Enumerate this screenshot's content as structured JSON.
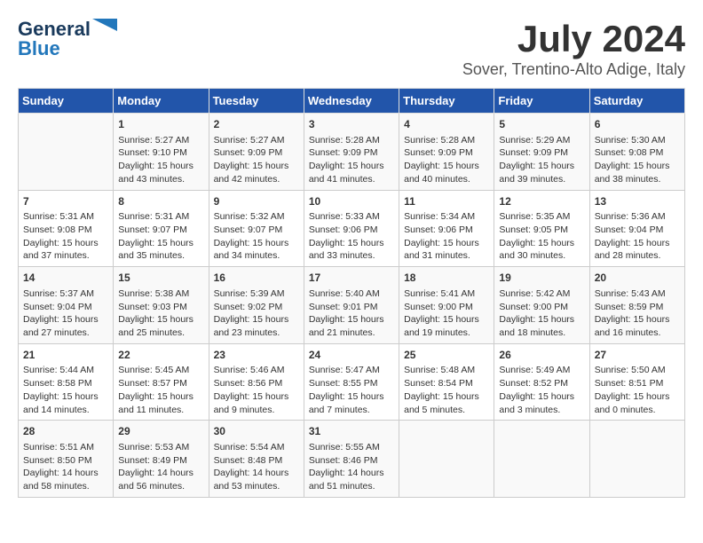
{
  "header": {
    "logo_line1": "General",
    "logo_line2": "Blue",
    "title": "July 2024",
    "location": "Sover, Trentino-Alto Adige, Italy"
  },
  "columns": [
    "Sunday",
    "Monday",
    "Tuesday",
    "Wednesday",
    "Thursday",
    "Friday",
    "Saturday"
  ],
  "weeks": [
    [
      {
        "day": "",
        "content": ""
      },
      {
        "day": "1",
        "content": "Sunrise: 5:27 AM\nSunset: 9:10 PM\nDaylight: 15 hours\nand 43 minutes."
      },
      {
        "day": "2",
        "content": "Sunrise: 5:27 AM\nSunset: 9:09 PM\nDaylight: 15 hours\nand 42 minutes."
      },
      {
        "day": "3",
        "content": "Sunrise: 5:28 AM\nSunset: 9:09 PM\nDaylight: 15 hours\nand 41 minutes."
      },
      {
        "day": "4",
        "content": "Sunrise: 5:28 AM\nSunset: 9:09 PM\nDaylight: 15 hours\nand 40 minutes."
      },
      {
        "day": "5",
        "content": "Sunrise: 5:29 AM\nSunset: 9:09 PM\nDaylight: 15 hours\nand 39 minutes."
      },
      {
        "day": "6",
        "content": "Sunrise: 5:30 AM\nSunset: 9:08 PM\nDaylight: 15 hours\nand 38 minutes."
      }
    ],
    [
      {
        "day": "7",
        "content": "Sunrise: 5:31 AM\nSunset: 9:08 PM\nDaylight: 15 hours\nand 37 minutes."
      },
      {
        "day": "8",
        "content": "Sunrise: 5:31 AM\nSunset: 9:07 PM\nDaylight: 15 hours\nand 35 minutes."
      },
      {
        "day": "9",
        "content": "Sunrise: 5:32 AM\nSunset: 9:07 PM\nDaylight: 15 hours\nand 34 minutes."
      },
      {
        "day": "10",
        "content": "Sunrise: 5:33 AM\nSunset: 9:06 PM\nDaylight: 15 hours\nand 33 minutes."
      },
      {
        "day": "11",
        "content": "Sunrise: 5:34 AM\nSunset: 9:06 PM\nDaylight: 15 hours\nand 31 minutes."
      },
      {
        "day": "12",
        "content": "Sunrise: 5:35 AM\nSunset: 9:05 PM\nDaylight: 15 hours\nand 30 minutes."
      },
      {
        "day": "13",
        "content": "Sunrise: 5:36 AM\nSunset: 9:04 PM\nDaylight: 15 hours\nand 28 minutes."
      }
    ],
    [
      {
        "day": "14",
        "content": "Sunrise: 5:37 AM\nSunset: 9:04 PM\nDaylight: 15 hours\nand 27 minutes."
      },
      {
        "day": "15",
        "content": "Sunrise: 5:38 AM\nSunset: 9:03 PM\nDaylight: 15 hours\nand 25 minutes."
      },
      {
        "day": "16",
        "content": "Sunrise: 5:39 AM\nSunset: 9:02 PM\nDaylight: 15 hours\nand 23 minutes."
      },
      {
        "day": "17",
        "content": "Sunrise: 5:40 AM\nSunset: 9:01 PM\nDaylight: 15 hours\nand 21 minutes."
      },
      {
        "day": "18",
        "content": "Sunrise: 5:41 AM\nSunset: 9:00 PM\nDaylight: 15 hours\nand 19 minutes."
      },
      {
        "day": "19",
        "content": "Sunrise: 5:42 AM\nSunset: 9:00 PM\nDaylight: 15 hours\nand 18 minutes."
      },
      {
        "day": "20",
        "content": "Sunrise: 5:43 AM\nSunset: 8:59 PM\nDaylight: 15 hours\nand 16 minutes."
      }
    ],
    [
      {
        "day": "21",
        "content": "Sunrise: 5:44 AM\nSunset: 8:58 PM\nDaylight: 15 hours\nand 14 minutes."
      },
      {
        "day": "22",
        "content": "Sunrise: 5:45 AM\nSunset: 8:57 PM\nDaylight: 15 hours\nand 11 minutes."
      },
      {
        "day": "23",
        "content": "Sunrise: 5:46 AM\nSunset: 8:56 PM\nDaylight: 15 hours\nand 9 minutes."
      },
      {
        "day": "24",
        "content": "Sunrise: 5:47 AM\nSunset: 8:55 PM\nDaylight: 15 hours\nand 7 minutes."
      },
      {
        "day": "25",
        "content": "Sunrise: 5:48 AM\nSunset: 8:54 PM\nDaylight: 15 hours\nand 5 minutes."
      },
      {
        "day": "26",
        "content": "Sunrise: 5:49 AM\nSunset: 8:52 PM\nDaylight: 15 hours\nand 3 minutes."
      },
      {
        "day": "27",
        "content": "Sunrise: 5:50 AM\nSunset: 8:51 PM\nDaylight: 15 hours\nand 0 minutes."
      }
    ],
    [
      {
        "day": "28",
        "content": "Sunrise: 5:51 AM\nSunset: 8:50 PM\nDaylight: 14 hours\nand 58 minutes."
      },
      {
        "day": "29",
        "content": "Sunrise: 5:53 AM\nSunset: 8:49 PM\nDaylight: 14 hours\nand 56 minutes."
      },
      {
        "day": "30",
        "content": "Sunrise: 5:54 AM\nSunset: 8:48 PM\nDaylight: 14 hours\nand 53 minutes."
      },
      {
        "day": "31",
        "content": "Sunrise: 5:55 AM\nSunset: 8:46 PM\nDaylight: 14 hours\nand 51 minutes."
      },
      {
        "day": "",
        "content": ""
      },
      {
        "day": "",
        "content": ""
      },
      {
        "day": "",
        "content": ""
      }
    ]
  ]
}
